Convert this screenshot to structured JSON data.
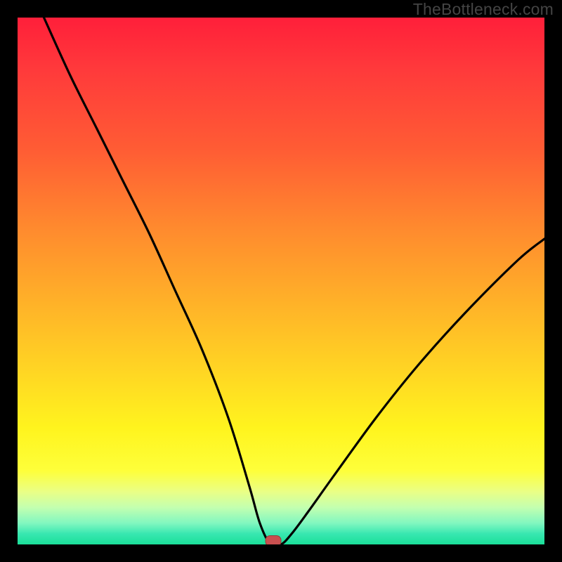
{
  "watermark": "TheBottleneck.com",
  "chart_data": {
    "type": "line",
    "title": "",
    "xlabel": "",
    "ylabel": "",
    "xlim": [
      0,
      100
    ],
    "ylim": [
      0,
      100
    ],
    "grid": false,
    "legend_position": "none",
    "background": "rainbow_gradient_red_to_green",
    "note": "V-shaped bottleneck curve; minimum at x≈48; axes have no visible tick labels or titles.",
    "series": [
      {
        "name": "bottleneck_curve",
        "x": [
          5,
          10,
          15,
          20,
          25,
          30,
          35,
          40,
          44,
          46,
          48,
          50,
          52,
          55,
          60,
          68,
          76,
          85,
          95,
          100
        ],
        "values": [
          100,
          89,
          79,
          69,
          59,
          48,
          37,
          24,
          11,
          4,
          0,
          0,
          2,
          6,
          13,
          24,
          34,
          44,
          54,
          58
        ]
      }
    ],
    "marker": {
      "x": 48.5,
      "y": 0,
      "shape": "rounded_rect",
      "color": "#c94f4f"
    }
  },
  "colors": {
    "frame": "#000000",
    "watermark": "#444444",
    "curve": "#000000",
    "marker": "#c94f4f"
  }
}
